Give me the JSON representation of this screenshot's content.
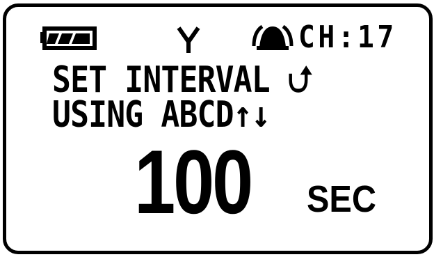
{
  "status": {
    "battery_icon": "battery-icon",
    "antenna_icon": "antenna-icon",
    "bell_icon": "bell-icon",
    "channel": "CH:17"
  },
  "display": {
    "line1": "SET INTERVAL ⮍",
    "line2": "USING ABCD↑↓",
    "value": "100",
    "unit": "SEC"
  }
}
